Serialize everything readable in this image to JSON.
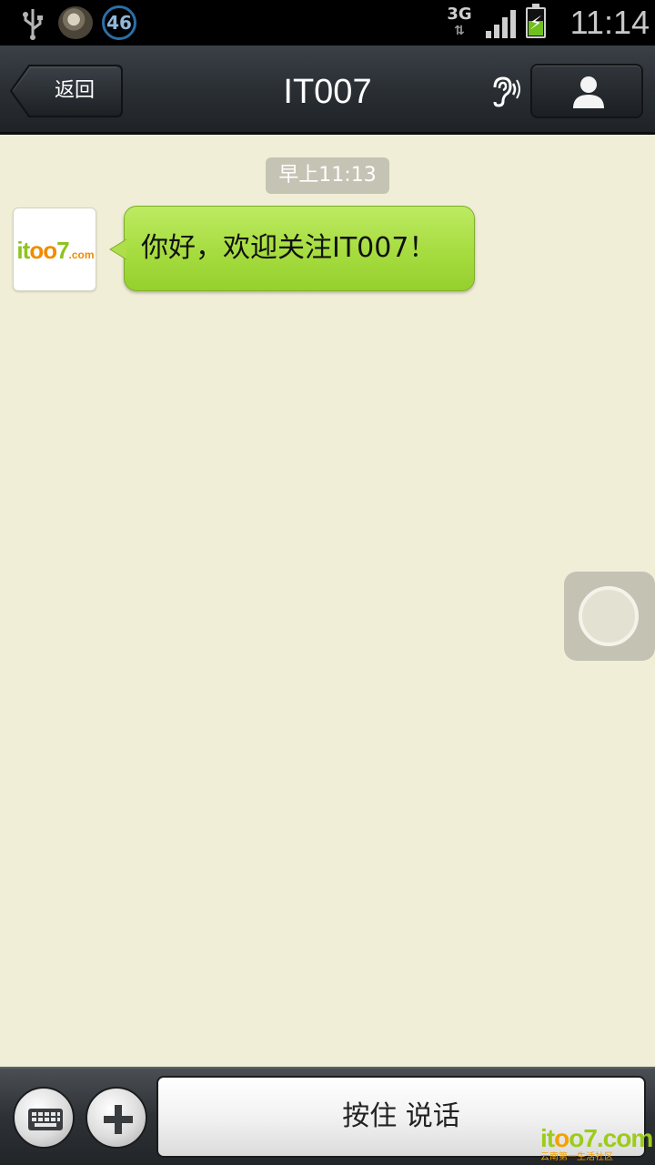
{
  "status_bar": {
    "icons": [
      "usb-icon",
      "app-icon",
      "notification-badge",
      "network-3g-icon",
      "signal-icon",
      "battery-charging-icon"
    ],
    "badge_count": "46",
    "network_type": "3G",
    "network_arrows": "⇅",
    "battery_level": 0.55,
    "time": "11:14"
  },
  "header": {
    "back_label": "返回",
    "title": "IT007",
    "speaker_mode_icon": "ear-icon",
    "profile_icon": "person-icon"
  },
  "chat": {
    "messages": [
      {
        "timestamp": "早上11:13",
        "sender_avatar_text": {
          "part1": "it",
          "part2": "oo",
          "part3": "7",
          "suffix": ".com"
        },
        "text": "你好，欢迎关注IT007！"
      }
    ]
  },
  "input_bar": {
    "keyboard_icon": "keyboard-icon",
    "plus_icon": "plus-icon",
    "talk_label": "按住 说话"
  },
  "watermark": {
    "logo_a": "it",
    "logo_b": "o",
    "logo_c": "o7.com",
    "tagline": "云南第一生活社区"
  },
  "colors": {
    "chat_background": "#f1eed8",
    "bubble_green": "#a6dc3f",
    "header_dark": "#2a2f34"
  }
}
